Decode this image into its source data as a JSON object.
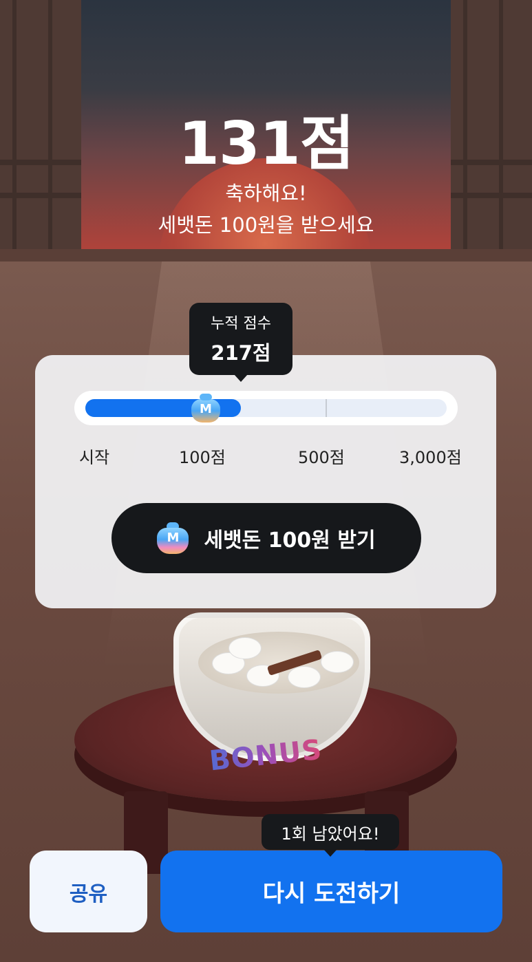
{
  "result": {
    "score_text": "131점",
    "congrats_line1": "축하해요!",
    "congrats_line2": "세뱃돈 100원을 받으세요"
  },
  "progress": {
    "tooltip_title": "누적 점수",
    "tooltip_value": "217점",
    "cumulative_score": 217,
    "fill_fraction": 0.43,
    "marker_icon": "money-bag-icon",
    "marker_text": "M",
    "milestones": [
      "시작",
      "100점",
      "500점",
      "3,000점"
    ]
  },
  "claim": {
    "icon": "money-bag-icon",
    "icon_text": "M",
    "label": "세뱃돈 100원 받기"
  },
  "bonus_label": "BONUS",
  "footer": {
    "share_label": "공유",
    "retry_label": "다시 도전하기",
    "remaining_tip": "1회 남았어요!"
  },
  "colors": {
    "accent_blue": "#1272ef",
    "dark": "#16181b",
    "card_bg": "#f0f0f2"
  }
}
